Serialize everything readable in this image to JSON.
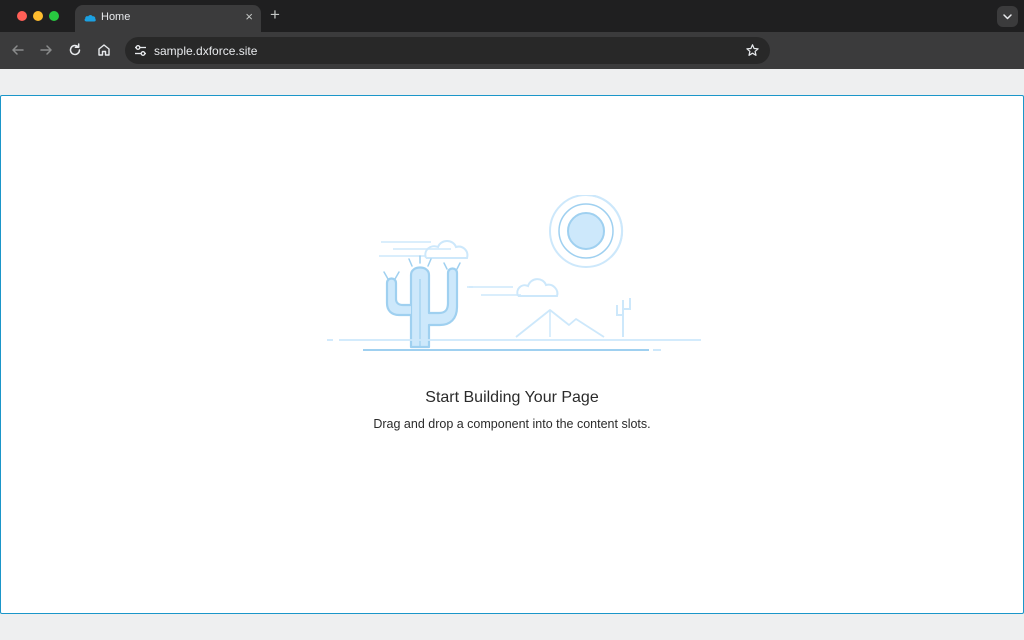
{
  "browser": {
    "tab": {
      "title": "Home",
      "close_glyph": "×",
      "favicon": "cloud-icon"
    },
    "new_tab_glyph": "+",
    "url": "sample.dxforce.site"
  },
  "content": {
    "title": "Start Building Your Page",
    "subtitle": "Drag and drop a component into the content slots."
  },
  "colors": {
    "accent_border": "#1b96c9",
    "illustration_fill": "#cde8fb",
    "illustration_stroke": "#9fd0f0"
  }
}
